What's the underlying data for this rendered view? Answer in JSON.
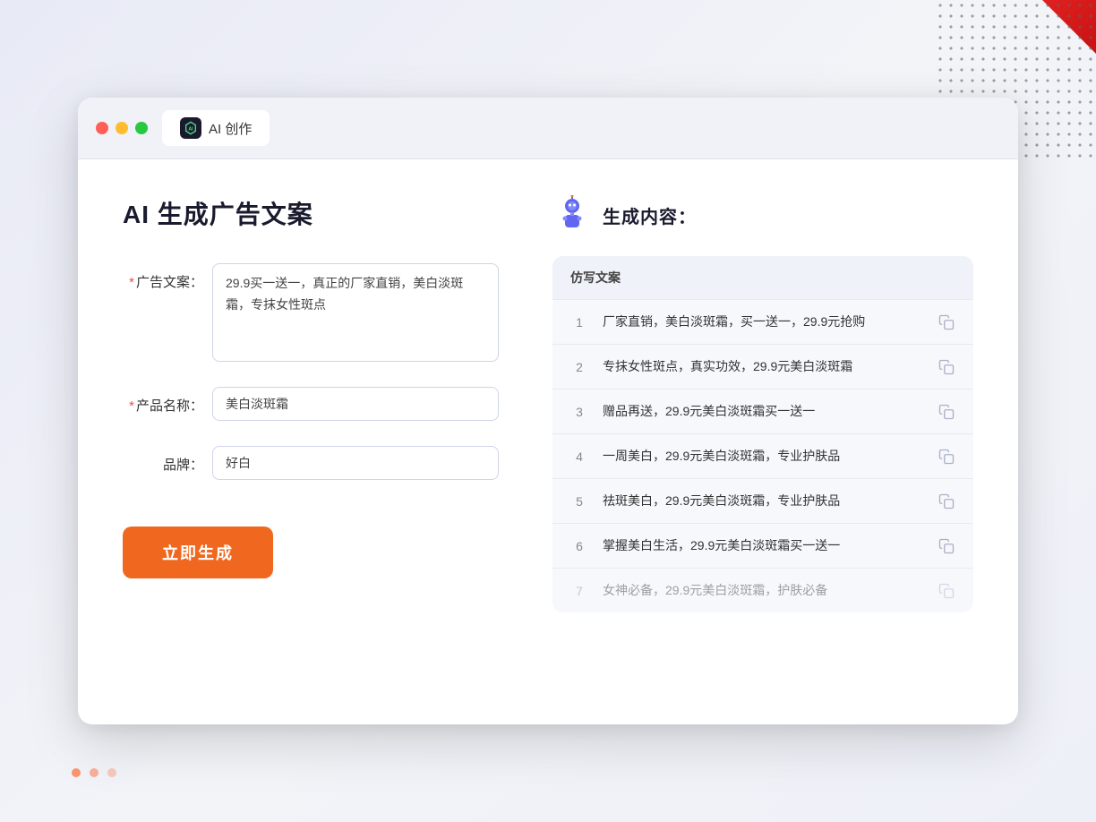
{
  "browser": {
    "tab_label": "AI 创作"
  },
  "header": {
    "title": "AI 生成广告文案"
  },
  "form": {
    "ad_copy_label": "广告文案：",
    "ad_copy_required": true,
    "ad_copy_value": "29.9买一送一，真正的厂家直销，美白淡斑霜，专抹女性斑点",
    "product_name_label": "产品名称：",
    "product_name_required": true,
    "product_name_value": "美白淡斑霜",
    "brand_label": "品牌：",
    "brand_required": false,
    "brand_value": "好白",
    "generate_btn_label": "立即生成"
  },
  "result": {
    "title": "生成内容：",
    "table_header": "仿写文案",
    "rows": [
      {
        "num": "1",
        "text": "厂家直销，美白淡斑霜，买一送一，29.9元抢购",
        "faded": false
      },
      {
        "num": "2",
        "text": "专抹女性斑点，真实功效，29.9元美白淡斑霜",
        "faded": false
      },
      {
        "num": "3",
        "text": "赠品再送，29.9元美白淡斑霜买一送一",
        "faded": false
      },
      {
        "num": "4",
        "text": "一周美白，29.9元美白淡斑霜，专业护肤品",
        "faded": false
      },
      {
        "num": "5",
        "text": "祛斑美白，29.9元美白淡斑霜，专业护肤品",
        "faded": false
      },
      {
        "num": "6",
        "text": "掌握美白生活，29.9元美白淡斑霜买一送一",
        "faded": false
      },
      {
        "num": "7",
        "text": "女神必备，29.9元美白淡斑霜，护肤必备",
        "faded": true
      }
    ]
  }
}
